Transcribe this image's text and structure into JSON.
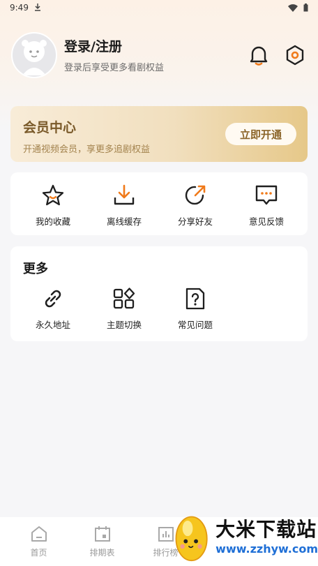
{
  "status_bar": {
    "time": "9:49"
  },
  "profile": {
    "title": "登录/注册",
    "subtitle": "登录后享受更多看剧权益"
  },
  "vip": {
    "title": "会员中心",
    "subtitle": "开通视频会员，享更多追剧权益",
    "button": "立即开通"
  },
  "features": [
    {
      "label": "我的收藏",
      "icon": "star-icon"
    },
    {
      "label": "离线缓存",
      "icon": "download-icon"
    },
    {
      "label": "分享好友",
      "icon": "share-icon"
    },
    {
      "label": "意见反馈",
      "icon": "feedback-icon"
    }
  ],
  "more": {
    "title": "更多",
    "items": [
      {
        "label": "永久地址",
        "icon": "link-icon"
      },
      {
        "label": "主题切换",
        "icon": "theme-icon"
      },
      {
        "label": "常见问题",
        "icon": "faq-icon"
      }
    ]
  },
  "tabbar": [
    {
      "label": "首页",
      "icon": "home-icon"
    },
    {
      "label": "排期表",
      "icon": "calendar-icon"
    },
    {
      "label": "排行榜",
      "icon": "chart-icon"
    }
  ],
  "watermark": {
    "title": "大米下载站",
    "url": "www.zzhyw.com"
  },
  "colors": {
    "accent": "#f07a1a",
    "gold": "#7a5a2a",
    "link": "#1f6fd6"
  }
}
